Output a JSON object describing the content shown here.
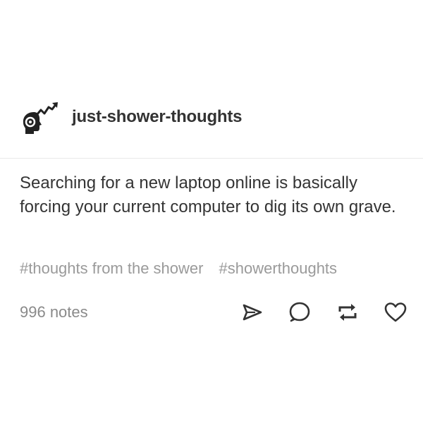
{
  "post": {
    "username": "just-shower-thoughts",
    "body": "Searching for a new laptop online is basically forcing your current computer to dig its own grave.",
    "tags": [
      "#thoughts from the shower",
      "#showerthoughts"
    ],
    "notes": "996 notes",
    "avatar_icon": "head-with-gear-and-rising-arrow-icon",
    "action_icons": [
      "share-icon",
      "reply-icon",
      "reblog-icon",
      "like-icon"
    ]
  }
}
